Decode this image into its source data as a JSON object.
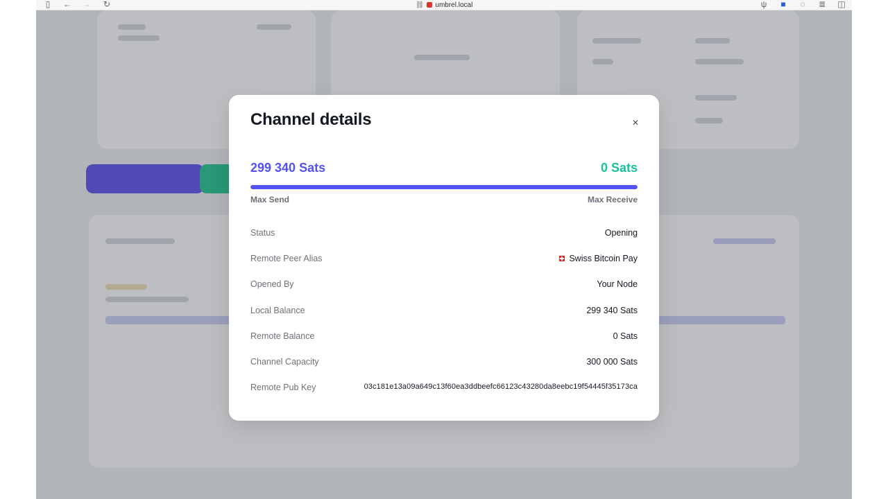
{
  "browser": {
    "url": "umbrel.local"
  },
  "modal": {
    "title": "Channel details",
    "close_label": "×",
    "max_send_amount": "299 340 Sats",
    "max_receive_amount": "0 Sats",
    "max_send_label": "Max Send",
    "max_receive_label": "Max Receive",
    "send_fraction": 1.0,
    "details": [
      {
        "key": "Status",
        "value": "Opening"
      },
      {
        "key": "Remote Peer Alias",
        "value": "Swiss Bitcoin Pay"
      },
      {
        "key": "Opened By",
        "value": "Your Node"
      },
      {
        "key": "Local Balance",
        "value": "299 340 Sats"
      },
      {
        "key": "Remote Balance",
        "value": "0 Sats"
      },
      {
        "key": "Channel Capacity",
        "value": "300 000 Sats"
      },
      {
        "key": "Remote Pub Key",
        "value": "03c181e13a09a649c13f60ea3ddbeefc66123c43280da8eebc19f54445f35173ca"
      }
    ]
  },
  "colors": {
    "accent_blue": "#5351f1",
    "accent_green": "#17c39b"
  },
  "icons": [
    "sidebar-icon",
    "back-arrow-icon",
    "forward-arrow-icon",
    "reload-icon",
    "link-icon",
    "lock-icon",
    "extension-icon",
    "profile-icon",
    "chat-icon",
    "reader-icon",
    "split-view-icon",
    "close-icon",
    "swiss-flag-icon"
  ]
}
